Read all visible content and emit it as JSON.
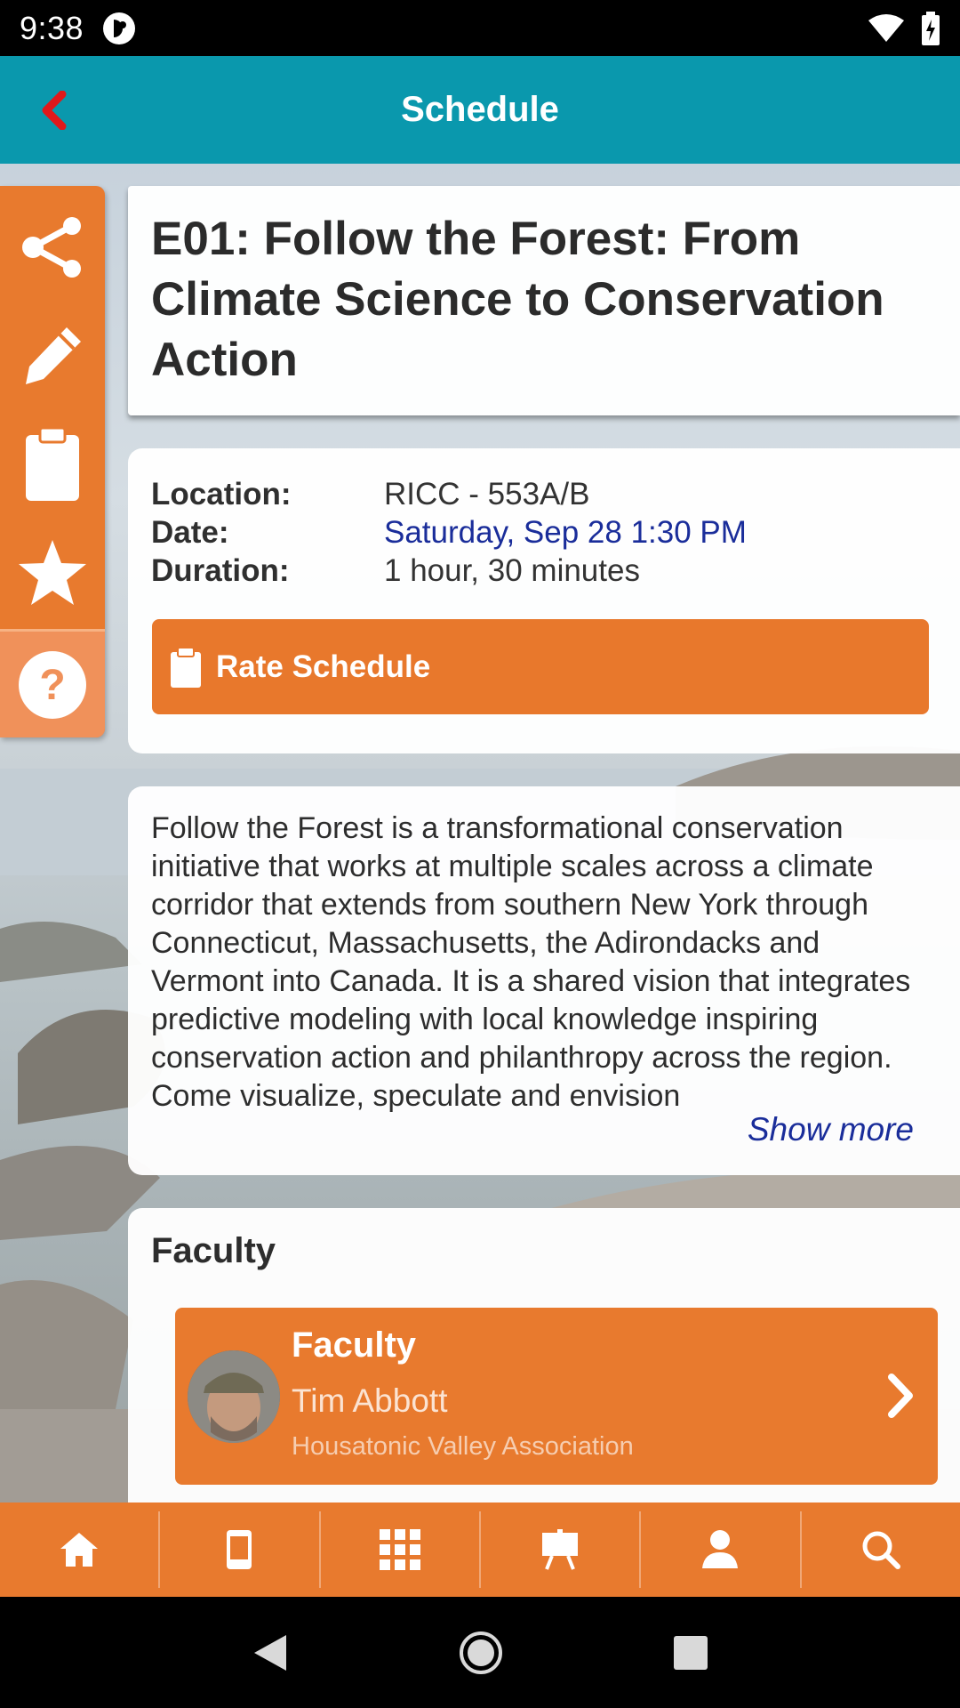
{
  "status_bar": {
    "time": "9:38"
  },
  "app_bar": {
    "title": "Schedule"
  },
  "side_toolbar": {
    "items": [
      {
        "icon": "share-icon"
      },
      {
        "icon": "pencil-icon"
      },
      {
        "icon": "clipboard-icon"
      },
      {
        "icon": "star-icon"
      },
      {
        "icon": "help-icon"
      }
    ]
  },
  "session": {
    "title": "E01: Follow the Forest: From Climate Science to Conservation Action",
    "location_label": "Location:",
    "location": "RICC - 553A/B",
    "date_label": "Date:",
    "date": "Saturday, Sep 28 1:30 PM",
    "duration_label": "Duration:",
    "duration": "1 hour, 30 minutes",
    "rate_button": "Rate Schedule",
    "description": "Follow the Forest is a transformational conservation initiative that works at multiple scales across a climate corridor that extends from southern New York through Connecticut, Massachusetts, the Adirondacks and Vermont into Canada. It is a shared vision that integrates predictive modeling with local knowledge inspiring conservation action and philanthropy across the region. Come visualize, speculate and envision",
    "show_more": "Show more"
  },
  "faculty": {
    "heading": "Faculty",
    "items": [
      {
        "role": "Faculty",
        "name": "Tim Abbott",
        "organization": "Housatonic Valley Association"
      }
    ]
  },
  "bottom_nav": {
    "items": [
      {
        "icon": "home-icon"
      },
      {
        "icon": "mobile-device-icon"
      },
      {
        "icon": "grid-icon"
      },
      {
        "icon": "presentation-icon"
      },
      {
        "icon": "speaker-icon"
      },
      {
        "icon": "search-icon"
      }
    ]
  },
  "colors": {
    "app_bar": "#0a98ad",
    "accent_orange": "#e87a2e",
    "back_arrow": "#e0191b",
    "link_blue": "#1a2d9a"
  }
}
